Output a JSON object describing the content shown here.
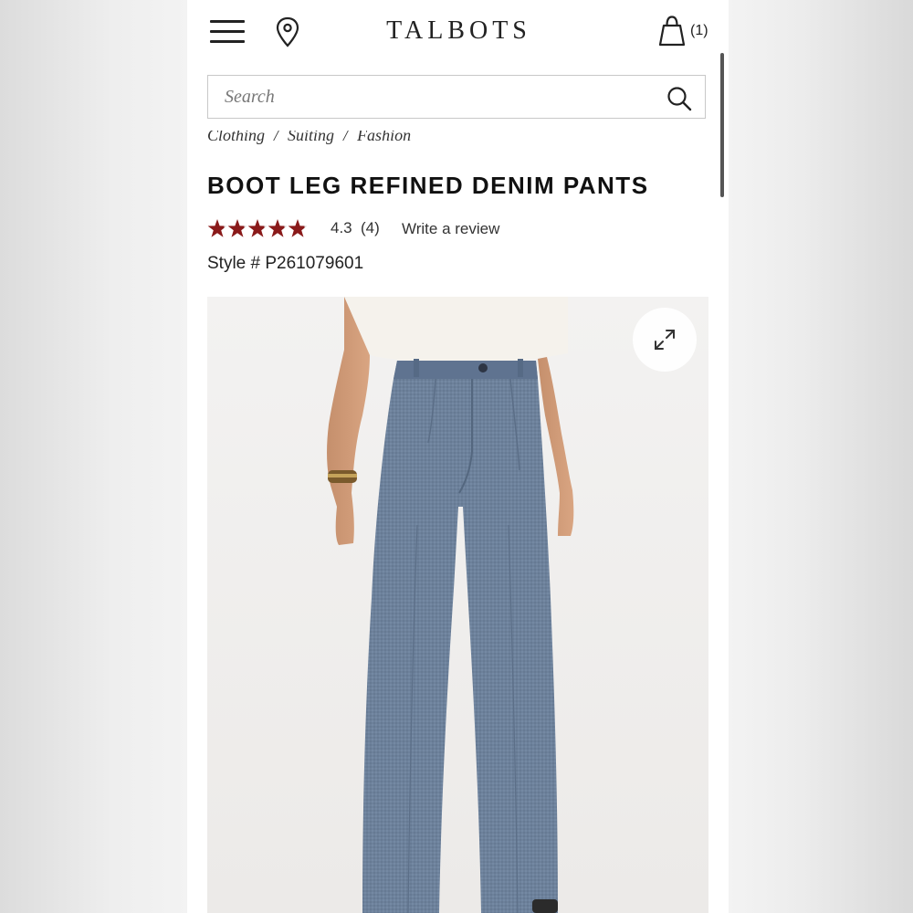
{
  "header": {
    "logo": "TALBOTS",
    "bag_count": "(1)"
  },
  "search": {
    "placeholder": "Search"
  },
  "breadcrumb": [
    "Clothing",
    "Suiting",
    "Fashion"
  ],
  "product": {
    "title": "BOOT LEG REFINED DENIM PANTS",
    "rating_value": "4.3",
    "rating_count": "(4)",
    "rating_fraction": 0.86,
    "write_review": "Write a review",
    "style": "Style # P261079601"
  },
  "icons": {
    "menu": "hamburger-menu-icon",
    "location": "location-pin-icon",
    "bag": "shopping-bag-icon",
    "search": "search-icon",
    "expand": "expand-icon",
    "star": "star-icon"
  },
  "colors": {
    "star": "#8a1a1a",
    "star_empty": "#d8d8d8",
    "text": "#222222",
    "denim": "#6b7f99"
  }
}
